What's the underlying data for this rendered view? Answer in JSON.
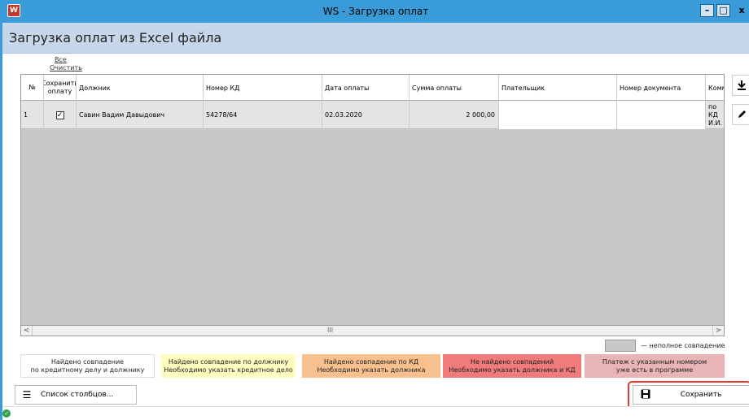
{
  "window": {
    "title": "WS - Загрузка оплат",
    "min_label": "–",
    "max_label": "□",
    "close_label": "x"
  },
  "page": {
    "title": "Загрузка оплат из Excel файла"
  },
  "selection": {
    "all_label": "Все",
    "clear_label": "Очистить"
  },
  "table": {
    "headers": [
      "№",
      "Сохранить оплату",
      "Должник",
      "Номер КД",
      "Дата оплаты",
      "Сумма оплаты",
      "Плательщик",
      "Номер документа",
      "Комм"
    ],
    "rows": [
      {
        "num": "1",
        "save": true,
        "debtor": "Савин Вадим Давыдович",
        "kd": "54278/64",
        "date": "02.03.2020",
        "amount": "2 000,00",
        "payer": "",
        "doc": "",
        "comment": "по КД И.И."
      }
    ]
  },
  "scroll": {
    "left": "<",
    "right": ">",
    "thumb": "III"
  },
  "legend": {
    "partial": "— неполное совпадение",
    "items": [
      {
        "line1": "Найдено совпадение",
        "line2": "по кредитному делу и должнику",
        "color": "#ffffff"
      },
      {
        "line1": "Найдено совпадение по должнику",
        "line2": "Необходимо указать кредитное дело",
        "color": "#fffdc0"
      },
      {
        "line1": "Найдено совпадение по КД",
        "line2": "Необходимо указать должника",
        "color": "#f8c08e"
      },
      {
        "line1": "Не найдено совпадений",
        "line2": "Необходимо указать должника и КД",
        "color": "#ef7b7b"
      },
      {
        "line1": "Платеж с указанным номером",
        "line2": "уже есть в программе",
        "color": "#e9b4b6"
      }
    ]
  },
  "toolbar": {
    "columns_label": "Список столбцов...",
    "save_label": "Сохранить"
  },
  "icons": {
    "download": "download-icon",
    "edit": "pencil-icon",
    "list": "list-icon",
    "save": "floppy-disk-icon",
    "status": "check-circle-icon"
  },
  "colors": {
    "titlebar": "#3a9bd9",
    "header_band": "#c7d6ea",
    "highlight": "#e53935"
  }
}
